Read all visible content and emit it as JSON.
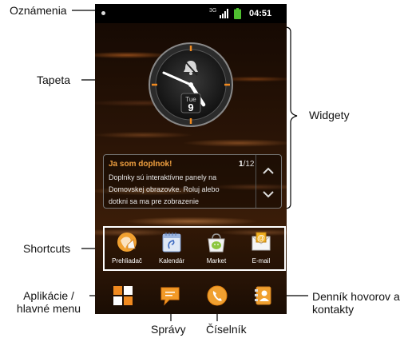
{
  "callouts": {
    "notifications": "Oznámenia",
    "wallpaper": "Tapeta",
    "widgets": "Widgety",
    "shortcuts": "Shortcuts",
    "apps_line1": "Aplikácie /",
    "apps_line2": "hlavné menu",
    "messages": "Správy",
    "dialer": "Číselník",
    "calllog_line1": "Denník hovorov a",
    "calllog_line2": "kontakty"
  },
  "status_bar": {
    "network": "3G",
    "time": "04:51",
    "icons": [
      "notification-dot-icon",
      "network-3g-icon",
      "signal-icon",
      "battery-icon"
    ]
  },
  "clock_widget": {
    "weekday": "Tue",
    "day": "9",
    "icons": [
      "alarm-off-icon"
    ]
  },
  "notice_widget": {
    "title": "Ja som doplnok!",
    "page_current": "1",
    "page_total": "/12",
    "body_lines": [
      "Doplnky sú interaktívne panely na",
      "Domovskej obrazovke. Roluj alebo",
      "dotkni sa ma pre zobrazenie"
    ]
  },
  "shortcuts": [
    {
      "label": "Prehliadač",
      "icon": "browser-icon"
    },
    {
      "label": "Kalendár",
      "icon": "calendar-icon"
    },
    {
      "label": "Market",
      "icon": "market-icon"
    },
    {
      "label": "E-mail",
      "icon": "email-icon"
    }
  ],
  "dock": [
    {
      "icon": "apps-grid-icon"
    },
    {
      "icon": "messages-icon"
    },
    {
      "icon": "phone-icon"
    },
    {
      "icon": "contacts-icon"
    }
  ],
  "colors": {
    "accent_orange": "#f0a040",
    "status_bar": "#000000",
    "battery_green": "#4fc030"
  }
}
